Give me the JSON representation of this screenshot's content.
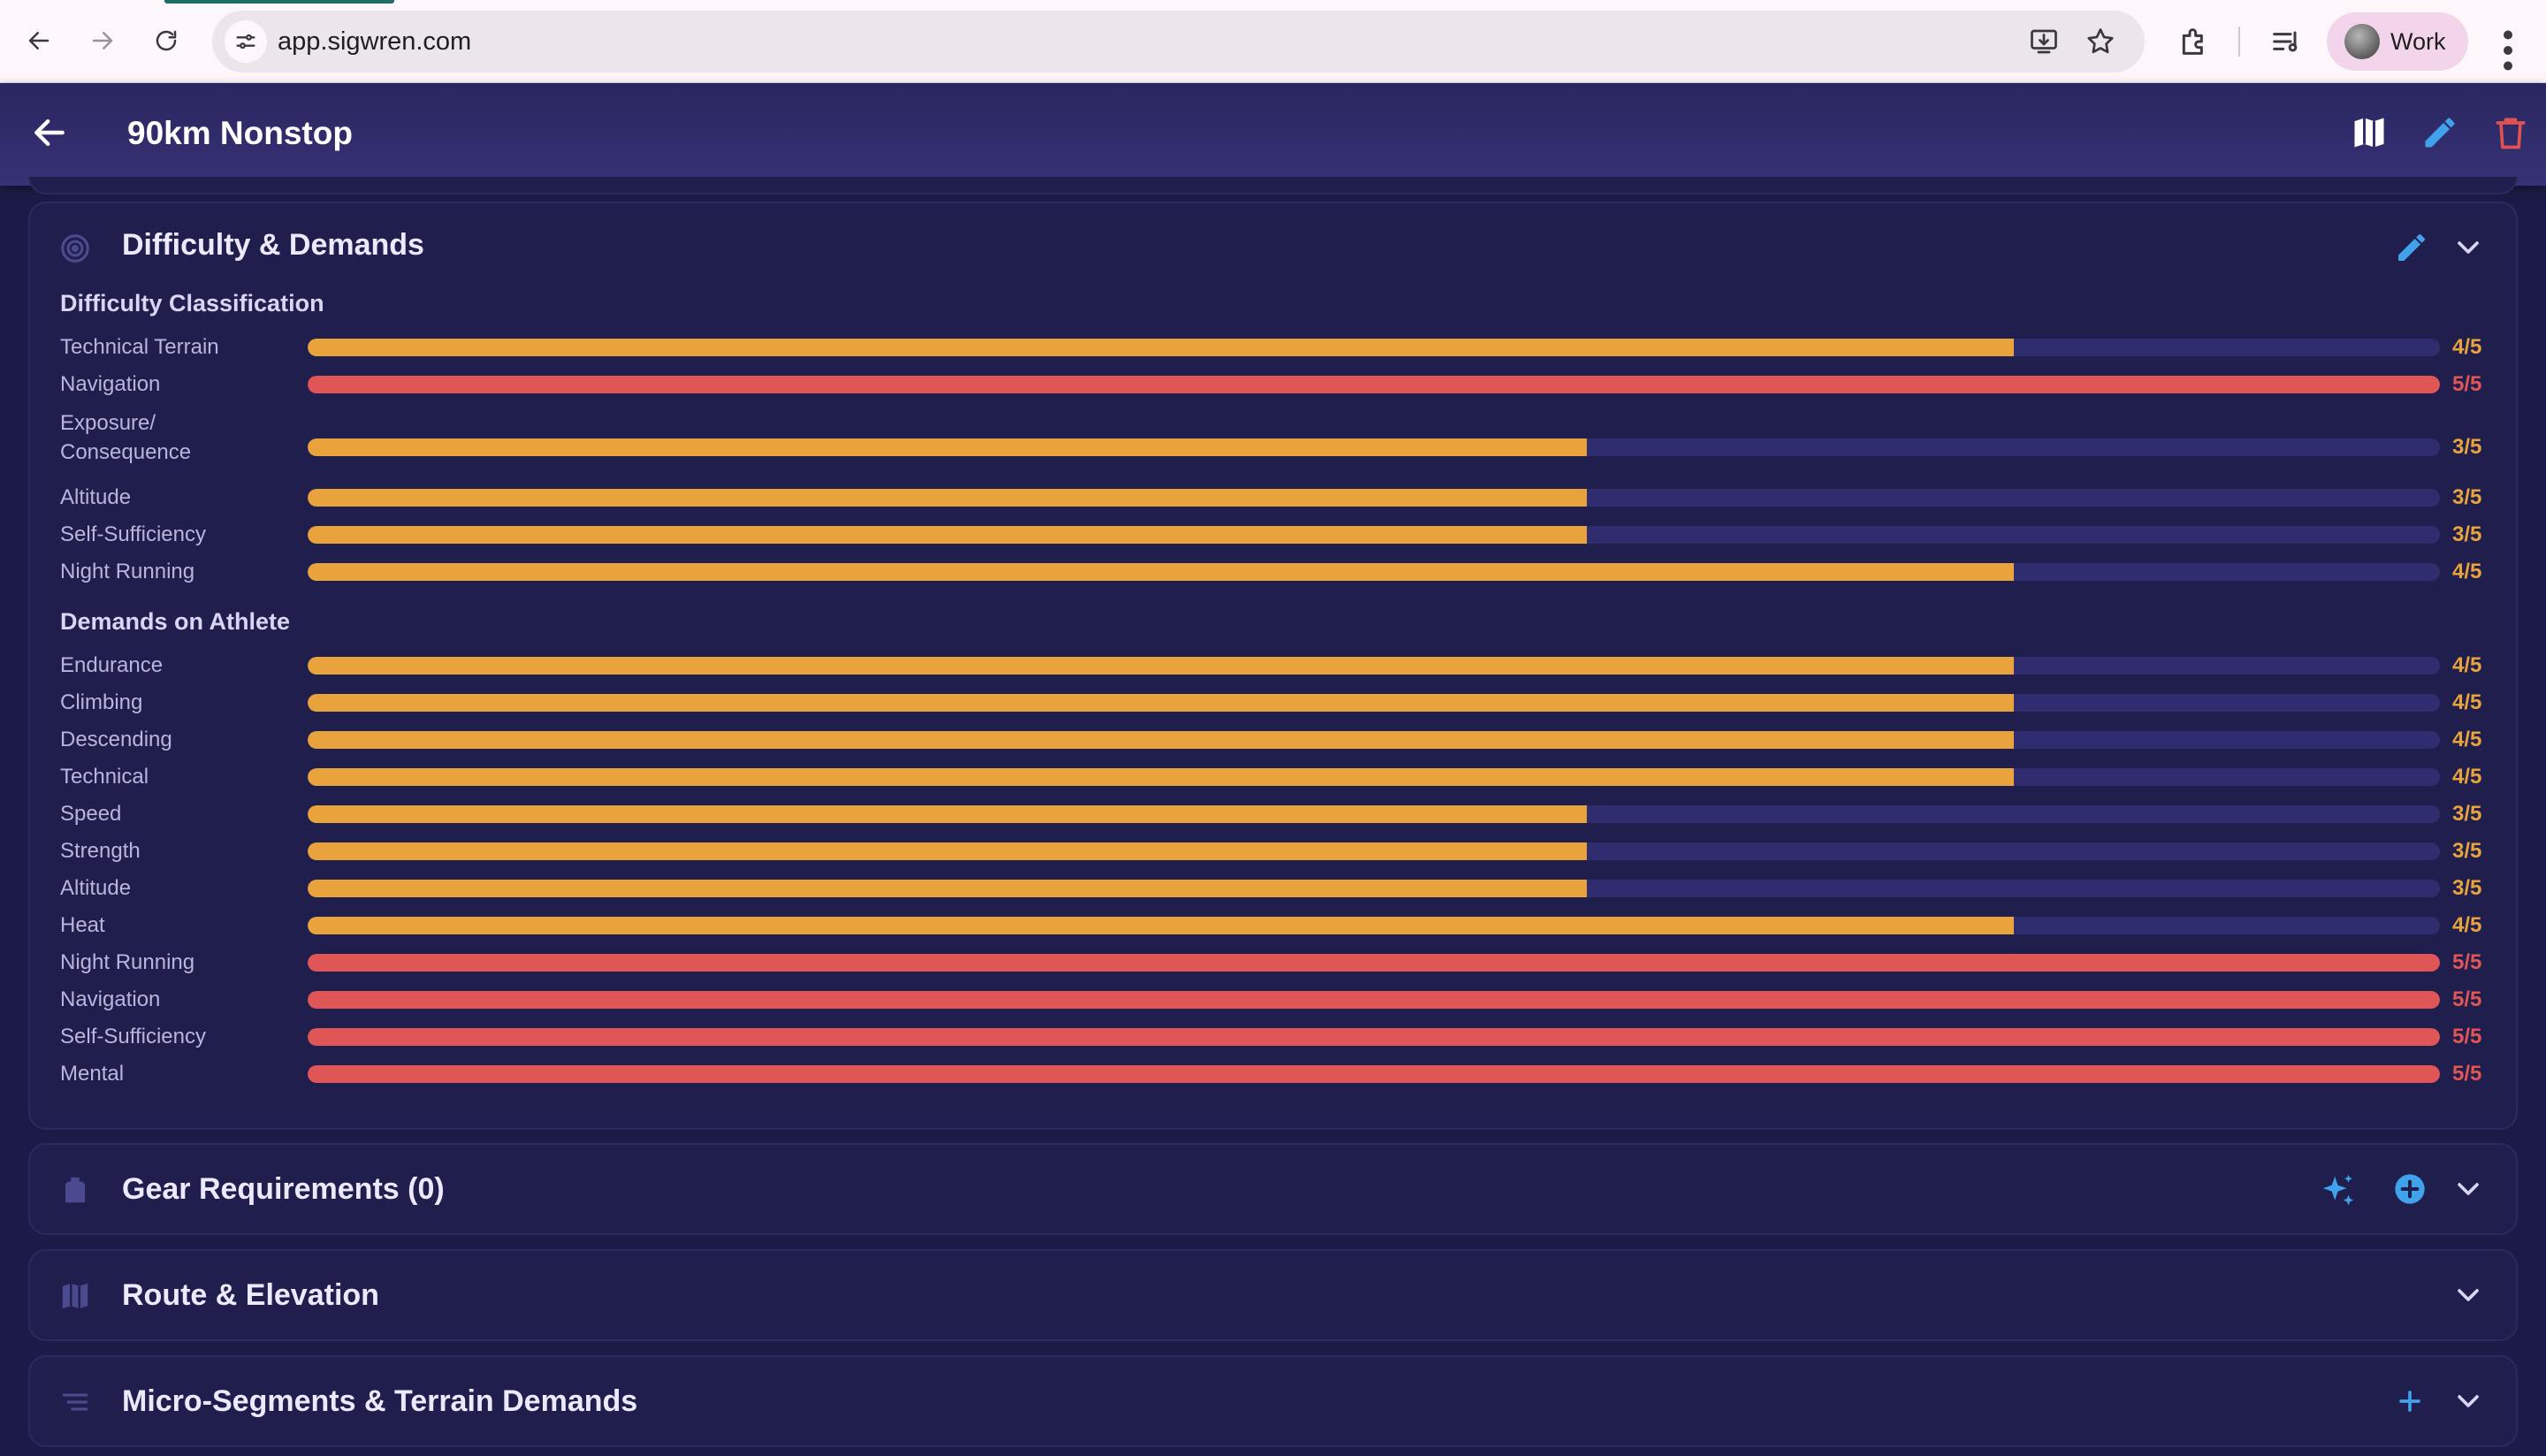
{
  "browser": {
    "url": "app.sigwren.com",
    "profile_label": "Work"
  },
  "header": {
    "title": "90km Nonstop"
  },
  "difficulty_card": {
    "title": "Difficulty & Demands",
    "classification_label": "Difficulty Classification",
    "classification": [
      {
        "label": "Technical Terrain",
        "value": 4,
        "max": 5,
        "display": "4/5"
      },
      {
        "label": "Navigation",
        "value": 5,
        "max": 5,
        "display": "5/5"
      },
      {
        "label": "Exposure/\nConsequence",
        "value": 3,
        "max": 5,
        "display": "3/5"
      },
      {
        "label": "Altitude",
        "value": 3,
        "max": 5,
        "display": "3/5"
      },
      {
        "label": "Self-Sufficiency",
        "value": 3,
        "max": 5,
        "display": "3/5"
      },
      {
        "label": "Night Running",
        "value": 4,
        "max": 5,
        "display": "4/5"
      }
    ],
    "demands_label": "Demands on Athlete",
    "demands": [
      {
        "label": "Endurance",
        "value": 4,
        "max": 5,
        "display": "4/5"
      },
      {
        "label": "Climbing",
        "value": 4,
        "max": 5,
        "display": "4/5"
      },
      {
        "label": "Descending",
        "value": 4,
        "max": 5,
        "display": "4/5"
      },
      {
        "label": "Technical",
        "value": 4,
        "max": 5,
        "display": "4/5"
      },
      {
        "label": "Speed",
        "value": 3,
        "max": 5,
        "display": "3/5"
      },
      {
        "label": "Strength",
        "value": 3,
        "max": 5,
        "display": "3/5"
      },
      {
        "label": "Altitude",
        "value": 3,
        "max": 5,
        "display": "3/5"
      },
      {
        "label": "Heat",
        "value": 4,
        "max": 5,
        "display": "4/5"
      },
      {
        "label": "Night Running",
        "value": 5,
        "max": 5,
        "display": "5/5"
      },
      {
        "label": "Navigation",
        "value": 5,
        "max": 5,
        "display": "5/5"
      },
      {
        "label": "Self-Sufficiency",
        "value": 5,
        "max": 5,
        "display": "5/5"
      },
      {
        "label": "Mental",
        "value": 5,
        "max": 5,
        "display": "5/5"
      }
    ]
  },
  "gear_card": {
    "title": "Gear Requirements (0)"
  },
  "route_card": {
    "title": "Route & Elevation"
  },
  "segments_card": {
    "title": "Micro-Segments & Terrain Demands"
  },
  "colors": {
    "background": "#1c1b47",
    "card": "#1f1e4d",
    "track": "#2f2d70",
    "rating_high": "#e05555",
    "rating_mid": "#e8a33d",
    "accent_blue": "#3fa2ea",
    "delete_red": "#e05252"
  },
  "icons": {
    "difficulty": "target-icon",
    "gear": "backpack-icon",
    "route": "map-icon",
    "segments": "list-icon"
  }
}
